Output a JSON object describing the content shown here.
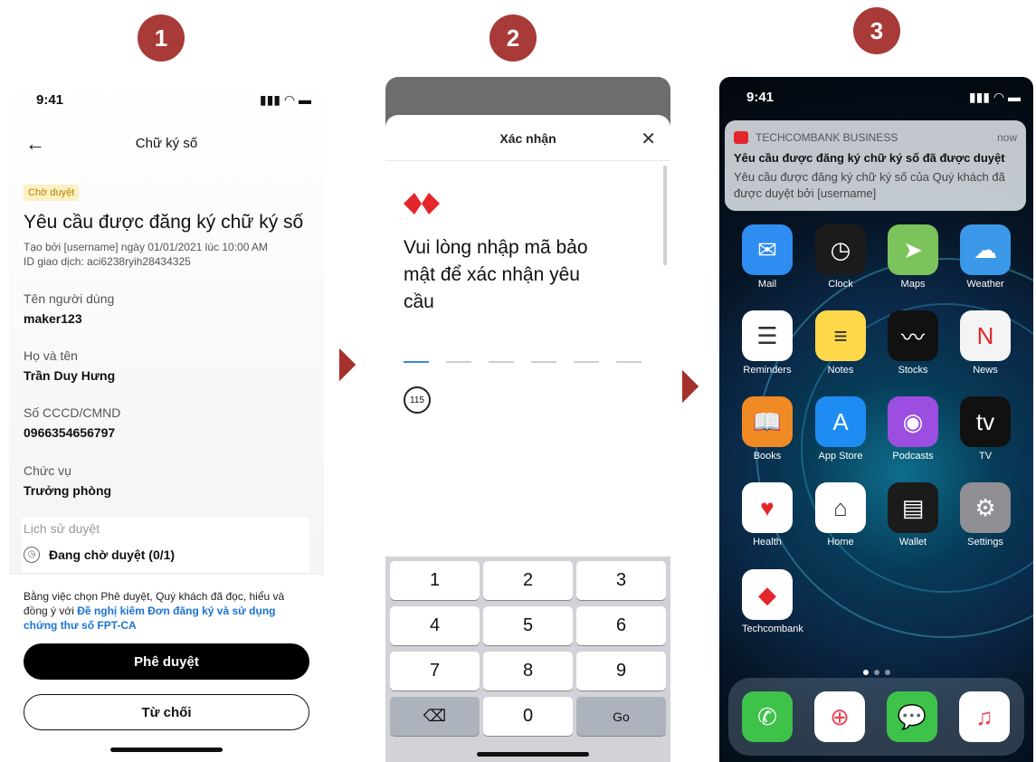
{
  "steps": [
    "1",
    "2",
    "3"
  ],
  "screen1": {
    "status_time": "9:41",
    "status_icons": "▮▮▮ ◠ ▬",
    "back_icon": "←",
    "title": "Chữ ký số",
    "badge": "Chờ duyệt",
    "heading": "Yêu cầu được đăng ký chữ ký số",
    "created_by": "Tạo bởi [username] ngày 01/01/2021 lúc 10:00 AM",
    "transaction_id": "ID giao dịch: aci6238ryih28434325",
    "fields": [
      {
        "label": "Tên người dùng",
        "value": "maker123"
      },
      {
        "label": "Họ và tên",
        "value": "Trần Duy Hưng"
      },
      {
        "label": "Số CCCD/CMND",
        "value": "0966354656797"
      },
      {
        "label": "Chức vụ",
        "value": "Trưởng phòng"
      }
    ],
    "history_label": "Lịch sử duyệt",
    "history_status": "Đang chờ duyệt (0/1)",
    "consent_text": "Bằng việc chọn Phê duyệt, Quý khách đã đọc, hiểu và đồng ý với ",
    "consent_link": "Đề nghị kiêm Đơn đăng ký và sử dụng chứng thư số FPT-CA",
    "approve_label": "Phê duyệt",
    "reject_label": "Từ chối"
  },
  "screen2": {
    "title": "Xác nhận",
    "close_icon": "✕",
    "prompt": "Vui lòng nhập mã bảo mật để xác nhận yêu cầu",
    "timer": "115",
    "keys": [
      "1",
      "2",
      "3",
      "4",
      "5",
      "6",
      "7",
      "8",
      "9",
      "⌫",
      "0",
      "Go"
    ]
  },
  "screen3": {
    "status_time": "9:41",
    "status_icons": "▮▮▮ ◠ ▬",
    "notification": {
      "app": "TECHCOMBANK BUSINESS",
      "time": "now",
      "title": "Yêu cầu được đăng ký chữ ký số đã được duyệt",
      "body": "Yêu cầu được đăng ký chữ ký số của Quý khách đã được duyệt bởi [username]"
    },
    "apps": [
      {
        "name": "Mail",
        "icon": "mail-icon",
        "color": "#2f8cf0",
        "glyph": "✉"
      },
      {
        "name": "Clock",
        "icon": "clock-icon",
        "color": "#1b1b1b",
        "glyph": "◷"
      },
      {
        "name": "Maps",
        "icon": "maps-icon",
        "color": "#7bc35b",
        "glyph": "➤"
      },
      {
        "name": "Weather",
        "icon": "weather-icon",
        "color": "#3b98e8",
        "glyph": "☁"
      },
      {
        "name": "Reminders",
        "icon": "reminders-icon",
        "color": "#ffffff",
        "glyph": "☰"
      },
      {
        "name": "Notes",
        "icon": "notes-icon",
        "color": "#ffd94a",
        "glyph": "≡"
      },
      {
        "name": "Stocks",
        "icon": "stocks-icon",
        "color": "#111111",
        "glyph": "〰"
      },
      {
        "name": "News",
        "icon": "news-icon",
        "color": "#f4f4f4",
        "glyph": "N"
      },
      {
        "name": "Books",
        "icon": "books-icon",
        "color": "#f08a24",
        "glyph": "📖"
      },
      {
        "name": "App Store",
        "icon": "app-store-icon",
        "color": "#1e8cf2",
        "glyph": "A"
      },
      {
        "name": "Podcasts",
        "icon": "podcasts-icon",
        "color": "#9b4ee0",
        "glyph": "◉"
      },
      {
        "name": "TV",
        "icon": "tv-icon",
        "color": "#111111",
        "glyph": "tv"
      },
      {
        "name": "Health",
        "icon": "health-icon",
        "color": "#ffffff",
        "glyph": "♥"
      },
      {
        "name": "Home",
        "icon": "home-icon",
        "color": "#ffffff",
        "glyph": "⌂"
      },
      {
        "name": "Wallet",
        "icon": "wallet-icon",
        "color": "#1b1b1b",
        "glyph": "▤"
      },
      {
        "name": "Settings",
        "icon": "settings-icon",
        "color": "#8e8e93",
        "glyph": "⚙"
      },
      {
        "name": "Techcombank",
        "icon": "techcombank-icon",
        "color": "#ffffff",
        "glyph": "◆"
      }
    ],
    "dock": [
      {
        "icon": "phone-icon",
        "color": "#3ec24a",
        "glyph": "✆"
      },
      {
        "icon": "safari-icon",
        "color": "#ffffff",
        "glyph": "⊕"
      },
      {
        "icon": "messages-icon",
        "color": "#3ec24a",
        "glyph": "💬"
      },
      {
        "icon": "music-icon",
        "color": "#ffffff",
        "glyph": "♫"
      }
    ]
  }
}
